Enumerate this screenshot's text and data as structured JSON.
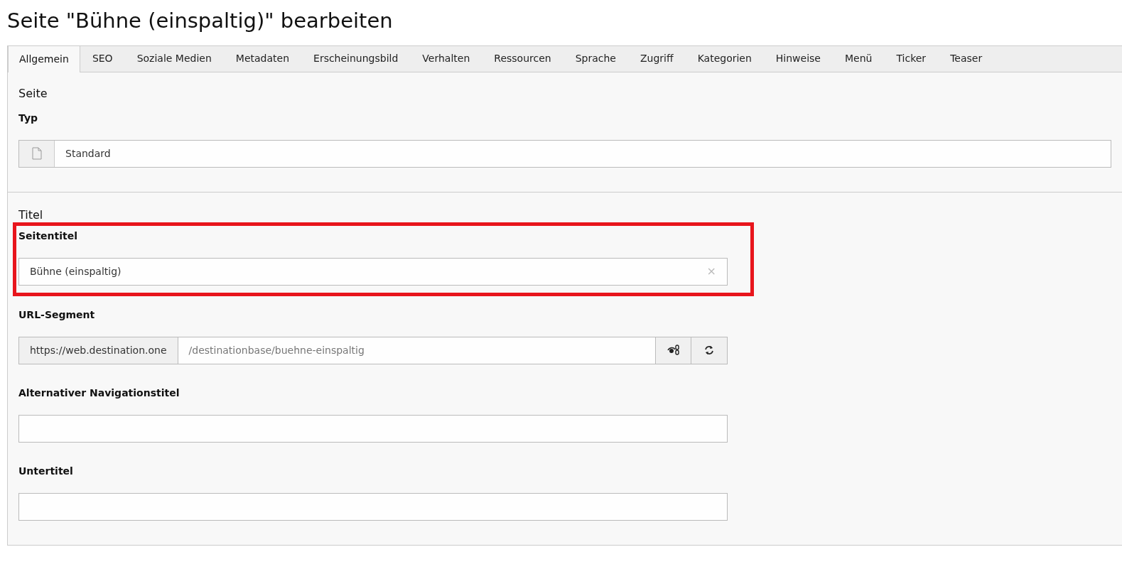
{
  "page_title": "Seite \"Bühne (einspaltig)\" bearbeiten",
  "tabs": [
    {
      "label": "Allgemein",
      "selected": true
    },
    {
      "label": "SEO",
      "selected": false
    },
    {
      "label": "Soziale Medien",
      "selected": false
    },
    {
      "label": "Metadaten",
      "selected": false
    },
    {
      "label": "Erscheinungsbild",
      "selected": false
    },
    {
      "label": "Verhalten",
      "selected": false
    },
    {
      "label": "Ressourcen",
      "selected": false
    },
    {
      "label": "Sprache",
      "selected": false
    },
    {
      "label": "Zugriff",
      "selected": false
    },
    {
      "label": "Kategorien",
      "selected": false
    },
    {
      "label": "Hinweise",
      "selected": false
    },
    {
      "label": "Menü",
      "selected": false
    },
    {
      "label": "Ticker",
      "selected": false
    },
    {
      "label": "Teaser",
      "selected": false
    }
  ],
  "sections": [
    {
      "heading": "Seite",
      "fields": [
        {
          "kind": "select",
          "label": "Typ",
          "value": "Standard",
          "highlighted": false
        }
      ]
    },
    {
      "heading": "Titel",
      "fields": [
        {
          "kind": "text",
          "label": "Seitentitel",
          "value": "Bühne (einspaltig)",
          "clear_button": "×",
          "highlighted": true
        },
        {
          "kind": "url",
          "label": "URL-Segment",
          "prefix": "https://web.destination.one",
          "value": "/destinationbase/buehne-einspaltig",
          "highlighted": false
        },
        {
          "kind": "text",
          "label": "Alternativer Navigationstitel",
          "highlighted": false
        },
        {
          "kind": "text",
          "label": "Untertitel",
          "highlighted": false
        }
      ]
    }
  ]
}
